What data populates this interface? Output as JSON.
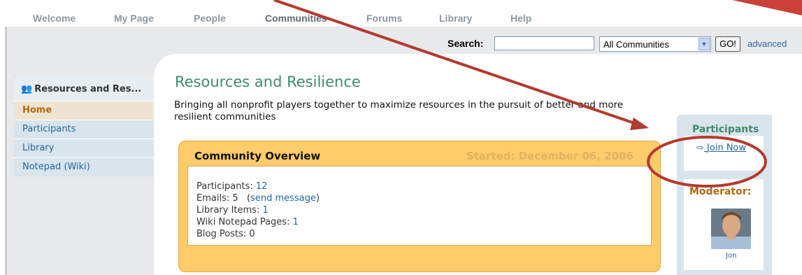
{
  "nav": {
    "items": [
      {
        "label": "Welcome"
      },
      {
        "label": "My Page"
      },
      {
        "label": "People"
      },
      {
        "label": "Communities"
      },
      {
        "label": "Forums"
      },
      {
        "label": "Library"
      },
      {
        "label": "Help"
      }
    ],
    "active": "Communities"
  },
  "search": {
    "label": "Search:",
    "value": "",
    "scope": "All Communities",
    "go": "GO!",
    "advanced": "advanced"
  },
  "sidebar": {
    "title": "Resources and Res...",
    "icon": "people-icon",
    "items": [
      {
        "label": "Home"
      },
      {
        "label": "Participants"
      },
      {
        "label": "Library"
      },
      {
        "label": "Notepad (Wiki)"
      }
    ]
  },
  "community": {
    "title": "Resources and Resilience",
    "description": "Bringing all nonprofit players together to maximize resources in the pursuit of better and more resilient communities"
  },
  "overview": {
    "title": "Community Overview",
    "started": "Started: December 06, 2006",
    "participants_label": "Participants:",
    "participants": "12",
    "emails_label": "Emails:",
    "emails": "5",
    "send_message": "send message",
    "library_label": "Library Items:",
    "library": "1",
    "wiki_label": "Wiki Notepad Pages:",
    "wiki": "1",
    "blog_label": "Blog Posts:",
    "blog": "0"
  },
  "right_panel": {
    "title": "Participants",
    "join": "Join Now",
    "moderator_label": "Moderator:",
    "moderator_name": "Jon"
  },
  "colors": {
    "accent_green": "#3f8b6d",
    "overview_orange": "#ffcb6b",
    "annotation_red": "#b43a2e",
    "link_blue": "#2267a0"
  }
}
